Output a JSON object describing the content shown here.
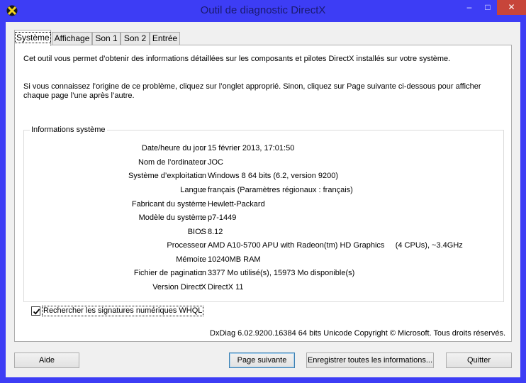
{
  "window": {
    "title": "Outil de diagnostic DirectX",
    "icon": "directx-icon",
    "controls": {
      "minimize": "–",
      "maximize": "□",
      "close": "✕"
    },
    "colors": {
      "titlebar": "#3d3df5",
      "close_button": "#c7453a"
    }
  },
  "tabs": [
    {
      "label": "Système",
      "active": true
    },
    {
      "label": "Affichage",
      "active": false
    },
    {
      "label": "Son 1",
      "active": false
    },
    {
      "label": "Son 2",
      "active": false
    },
    {
      "label": "Entrée",
      "active": false
    }
  ],
  "panel": {
    "intro1": "Cet outil vous permet d’obtenir des informations détaillées sur les composants et pilotes DirectX installés sur votre système.",
    "intro2": "Si vous connaissez l’origine de ce problème, cliquez sur l’onglet approprié. Sinon, cliquez sur Page suivante ci-dessous pour afficher chaque page l’une après l’autre.",
    "group_title": "Informations système",
    "info": [
      {
        "label": "Date/heure du jour",
        "value": "15 février 2013, 17:01:50"
      },
      {
        "label": "Nom de l’ordinateur",
        "value": "JOC"
      },
      {
        "label": "Système d’exploitation",
        "value": "Windows 8 64 bits (6.2, version 9200)"
      },
      {
        "label": "Langue",
        "value": "français (Paramètres régionaux : français)"
      },
      {
        "label": "Fabricant du système",
        "value": "Hewlett-Packard"
      },
      {
        "label": "Modèle du système",
        "value": "p7-1449"
      },
      {
        "label": "BIOS",
        "value": "8.12"
      },
      {
        "label": "Processeur",
        "value": "AMD A10-5700 APU with Radeon(tm) HD Graphics     (4 CPUs), ~3.4GHz"
      },
      {
        "label": "Mémoire",
        "value": "10240MB RAM"
      },
      {
        "label": "Fichier de pagination",
        "value": "3377 Mo utilisé(s), 15973 Mo disponible(s)"
      },
      {
        "label": "Version DirectX",
        "value": "DirectX 11"
      }
    ],
    "colon": ":",
    "whql_label": "Rechercher les signatures numériques WHQL",
    "whql_checked": true,
    "copyright": "DxDiag 6.02.9200.16384 64 bits Unicode Copyright © Microsoft. Tous droits réservés."
  },
  "buttons": {
    "help": "Aide",
    "next_page": "Page suivante",
    "save_all": "Enregistrer toutes les informations...",
    "quit": "Quitter"
  }
}
